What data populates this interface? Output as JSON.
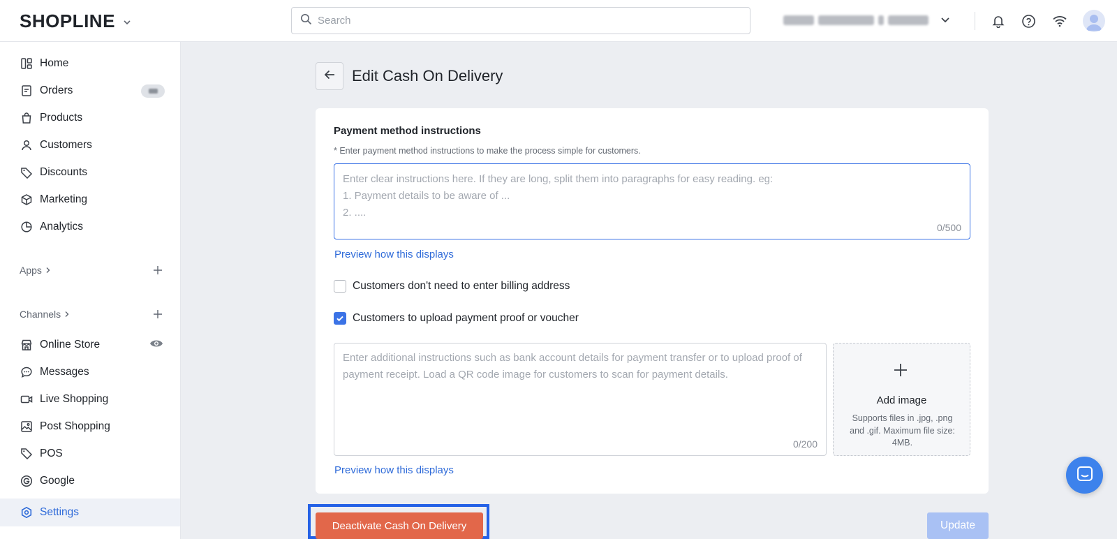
{
  "app": {
    "logo_text": "SHOPLINE",
    "search_placeholder": "Search"
  },
  "sidebar": {
    "items": [
      {
        "label": "Home",
        "icon": "home-icon"
      },
      {
        "label": "Orders",
        "icon": "orders-icon"
      },
      {
        "label": "Products",
        "icon": "bag-icon"
      },
      {
        "label": "Customers",
        "icon": "person-icon"
      },
      {
        "label": "Discounts",
        "icon": "tag-icon"
      },
      {
        "label": "Marketing",
        "icon": "cube-icon"
      },
      {
        "label": "Analytics",
        "icon": "pie-chart-icon"
      }
    ],
    "apps_label": "Apps",
    "channels_label": "Channels",
    "channels": [
      {
        "label": "Online Store",
        "icon": "store-icon"
      },
      {
        "label": "Messages",
        "icon": "chat-icon"
      },
      {
        "label": "Live Shopping",
        "icon": "video-icon"
      },
      {
        "label": "Post Shopping",
        "icon": "image-icon"
      },
      {
        "label": "POS",
        "icon": "pos-tag-icon"
      },
      {
        "label": "Google",
        "icon": "google-icon"
      }
    ],
    "settings_label": "Settings"
  },
  "page": {
    "title": "Edit Cash On Delivery"
  },
  "form": {
    "section_title": "Payment method instructions",
    "hint": "* Enter payment method instructions to make the process simple for customers.",
    "instructions_placeholder_1": "Enter clear instructions here. If they are long, split them into paragraphs for easy reading. eg:",
    "instructions_placeholder_2": "1. Payment details to be aware of ...",
    "instructions_placeholder_3": "2. ....",
    "instructions_counter": "0/500",
    "preview_link": "Preview how this displays",
    "billing_checkbox_label": "Customers don't need to enter billing address",
    "billing_checked": false,
    "proof_checkbox_label": "Customers to upload payment proof or voucher",
    "proof_checked": true,
    "proof_placeholder": "Enter additional instructions such as bank account details for payment transfer or to upload proof of payment receipt. Load a QR code image for customers to scan for payment details.",
    "proof_counter": "0/200",
    "add_image_label": "Add image",
    "add_image_hint": "Supports files in .jpg, .png and .gif. Maximum file size: 4MB.",
    "preview_link_2": "Preview how this displays"
  },
  "actions": {
    "deactivate_label": "Deactivate Cash On Delivery",
    "update_label": "Update"
  },
  "colors": {
    "accent": "#2f6bd9",
    "danger": "#e2674a",
    "update_disabled": "#a9c1f4",
    "highlight_frame": "#2461e6"
  }
}
